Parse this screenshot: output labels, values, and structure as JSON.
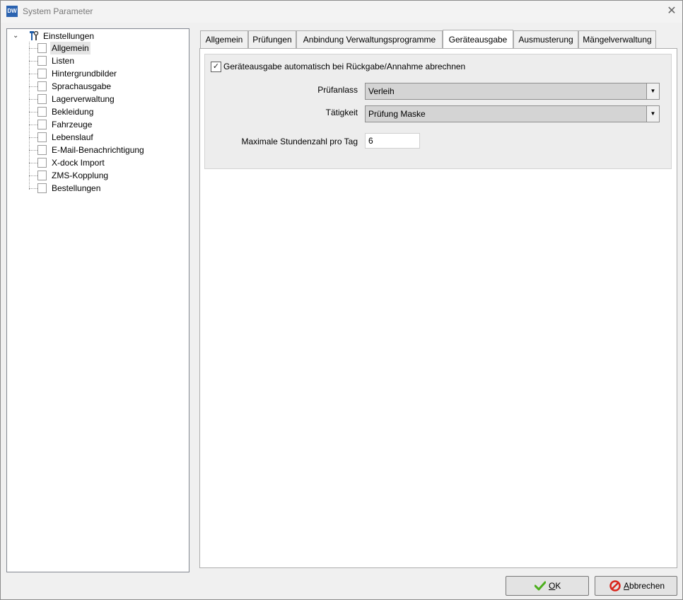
{
  "window": {
    "app_icon_text": "DW",
    "title": "System Parameter",
    "close_glyph": "✕"
  },
  "tree": {
    "root_label": "Einstellungen",
    "items": [
      {
        "label": "Allgemein",
        "selected": true
      },
      {
        "label": "Listen"
      },
      {
        "label": "Hintergrundbilder"
      },
      {
        "label": "Sprachausgabe"
      },
      {
        "label": "Lagerverwaltung"
      },
      {
        "label": "Bekleidung"
      },
      {
        "label": "Fahrzeuge"
      },
      {
        "label": "Lebenslauf"
      },
      {
        "label": "E-Mail-Benachrichtigung"
      },
      {
        "label": "X-dock Import"
      },
      {
        "label": "ZMS-Kopplung"
      },
      {
        "label": "Bestellungen"
      }
    ]
  },
  "tabs": [
    {
      "label": "Allgemein"
    },
    {
      "label": "Prüfungen"
    },
    {
      "label": "Anbindung Verwaltungsprogramme"
    },
    {
      "label": "Geräteausgabe",
      "active": true
    },
    {
      "label": "Ausmusterung"
    },
    {
      "label": "Mängelverwaltung"
    }
  ],
  "form": {
    "checkbox_label": "Geräteausgabe automatisch bei Rückgabe/Annahme abrechnen",
    "checkbox_checked": true,
    "pruefanlass_label": "Prüfanlass",
    "pruefanlass_value": "Verleih",
    "taetigkeit_label": "Tätigkeit",
    "taetigkeit_value": "Prüfung Maske",
    "stunden_label": "Maximale Stundenzahl pro Tag",
    "stunden_value": "6"
  },
  "buttons": {
    "ok_mnemonic": "O",
    "ok_rest": "K",
    "cancel_mnemonic": "A",
    "cancel_rest": "bbrechen"
  },
  "icons": {
    "root": "tools-icon",
    "ok": "checkmark-icon",
    "cancel": "cancel-icon"
  },
  "colors": {
    "ok_check": "#4caf1d",
    "cancel_red": "#d9261c",
    "app_icon": "#2b63b0"
  }
}
